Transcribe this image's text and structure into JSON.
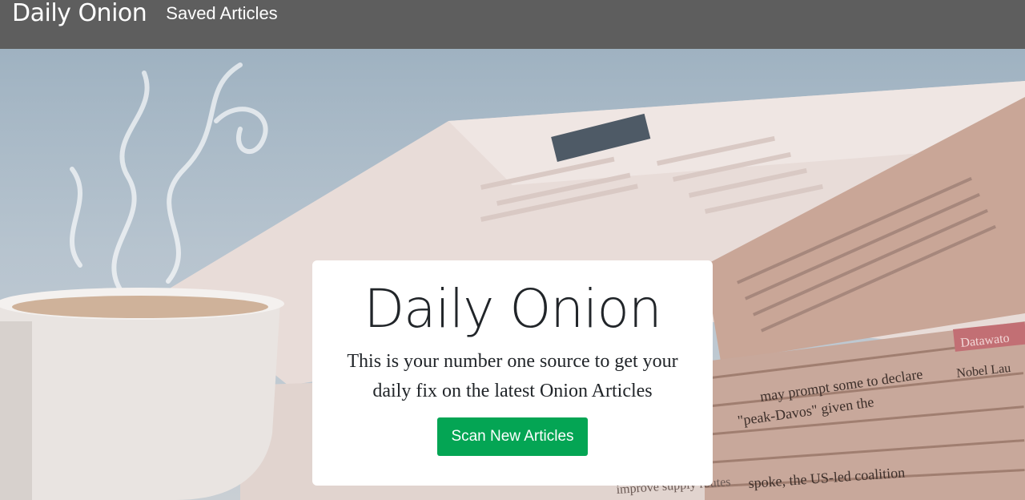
{
  "navbar": {
    "brand": "Daily Onion",
    "links": [
      {
        "label": "Saved Articles"
      }
    ]
  },
  "hero": {
    "background_image": "coffee-cup-and-newspapers-photo",
    "card": {
      "title": "Daily Onion",
      "text": "This is your number one source to get your daily fix on the latest Onion Articles",
      "button_label": "Scan New Articles"
    },
    "newspaper_text": [
      "may prompt some to declare",
      "\"peak-Davos\" given the",
      "Nobel Lau",
      "Datawato",
      "spoke, the US-led coalition",
      "improve supply routes"
    ]
  },
  "colors": {
    "navbar_bg": "#5e5e5e",
    "button_bg": "#04a554",
    "card_bg": "#ffffff"
  }
}
